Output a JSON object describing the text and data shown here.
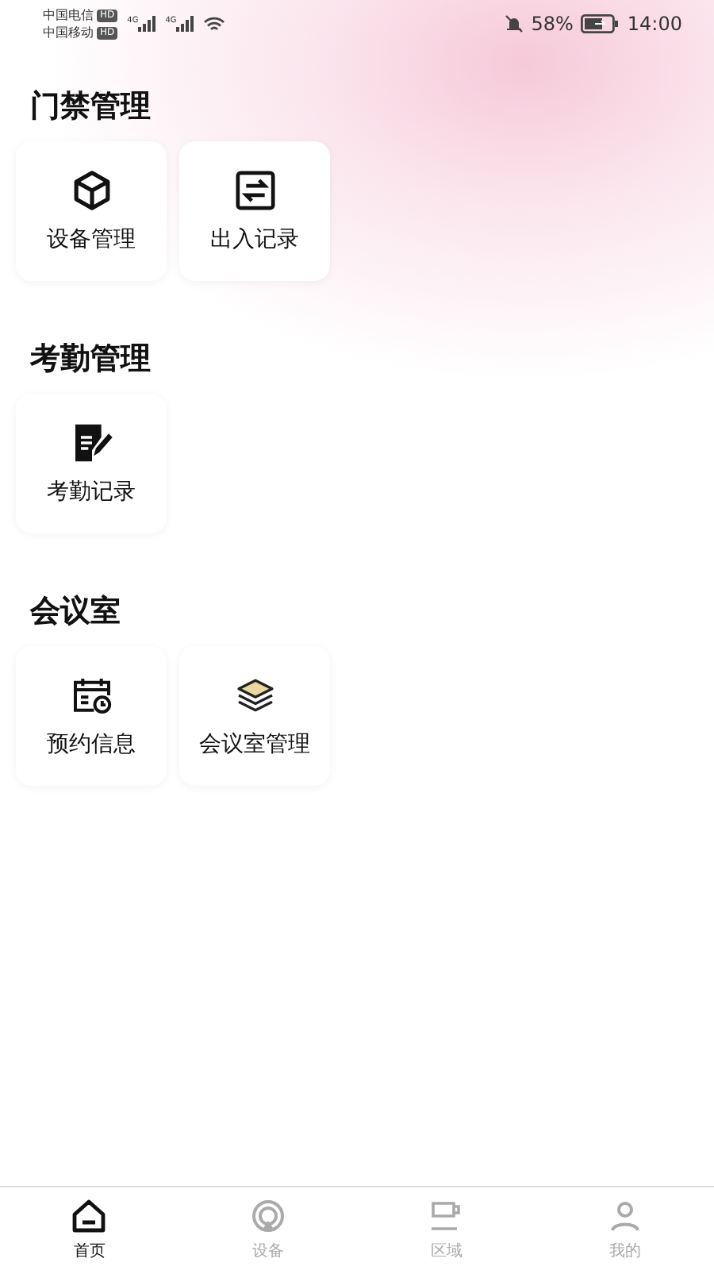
{
  "status_bar": {
    "carriers": [
      {
        "name": "中国电信",
        "badge": "HD",
        "network": "4G"
      },
      {
        "name": "中国移动",
        "badge": "HD",
        "network": "4G"
      }
    ],
    "battery": "58%",
    "time": "14:00"
  },
  "sections": [
    {
      "title": "门禁管理",
      "items": [
        {
          "label": "设备管理",
          "kind": "cube"
        },
        {
          "label": "出入记录",
          "kind": "swap"
        }
      ]
    },
    {
      "title": "考勤管理",
      "items": [
        {
          "label": "考勤记录",
          "kind": "note"
        }
      ]
    },
    {
      "title": "会议室",
      "items": [
        {
          "label": "预约信息",
          "kind": "calendar"
        },
        {
          "label": "会议室管理",
          "kind": "layers"
        }
      ]
    }
  ],
  "tabs": [
    {
      "label": "首页",
      "kind": "home",
      "selected": true
    },
    {
      "label": "设备",
      "kind": "device",
      "selected": false
    },
    {
      "label": "区域",
      "kind": "area",
      "selected": false
    },
    {
      "label": "我的",
      "kind": "user",
      "selected": false
    }
  ]
}
